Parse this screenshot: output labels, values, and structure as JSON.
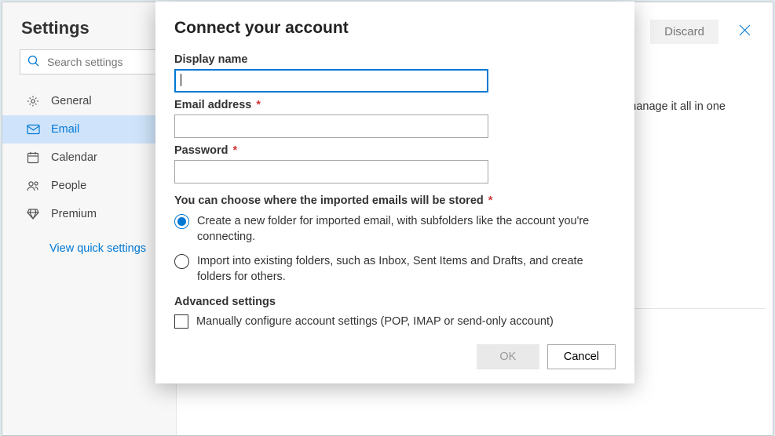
{
  "settings_title": "Settings",
  "search_placeholder": "Search settings",
  "nav": {
    "general": "General",
    "email": "Email",
    "calendar": "Calendar",
    "people": "People",
    "premium": "Premium"
  },
  "quick_settings_link": "View quick settings",
  "top_actions": {
    "discard": "Discard"
  },
  "background_text": "manage it all in one",
  "modal": {
    "title": "Connect your account",
    "display_name_label": "Display name",
    "display_name_value": "",
    "email_label": "Email address",
    "email_value": "",
    "password_label": "Password",
    "password_value": "",
    "storage_group_label": "You can choose where the imported emails will be stored",
    "radio_create": "Create a new folder for imported email, with subfolders like the account you're connecting.",
    "radio_import": "Import into existing folders, such as Inbox, Sent Items and Drafts, and create folders for others.",
    "advanced_label": "Advanced settings",
    "manual_config_label": "Manually configure account settings (POP, IMAP or send-only account)",
    "ok_label": "OK",
    "cancel_label": "Cancel",
    "storage_selected": "create",
    "manual_checked": false
  },
  "required_marker": "*"
}
